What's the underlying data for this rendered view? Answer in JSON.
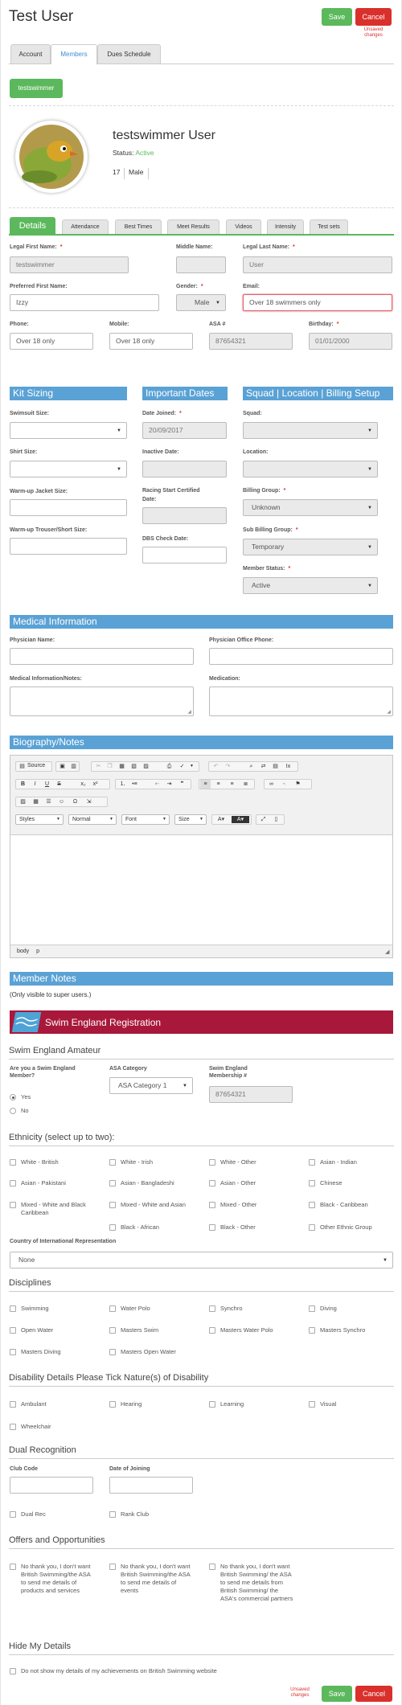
{
  "header": {
    "title": "Test User",
    "save_label": "Save",
    "cancel_label": "Cancel",
    "unsaved_line1": "Unsaved",
    "unsaved_line2": "changes"
  },
  "main_tabs": [
    {
      "label": "Account"
    },
    {
      "label": "Members"
    },
    {
      "label": "Dues Schedule"
    }
  ],
  "member_chip": "testswimmer",
  "profile": {
    "name": "testswimmer User",
    "status_label": "Status:",
    "status_value": "Active",
    "age": "17",
    "gender": "Male"
  },
  "detail_tabs": [
    {
      "label": "Details"
    },
    {
      "label": "Attendance"
    },
    {
      "label": "Best Times"
    },
    {
      "label": "Meet Results"
    },
    {
      "label": "Videos"
    },
    {
      "label": "Intensity"
    },
    {
      "label": "Test sets"
    }
  ],
  "details": {
    "legal_first_name_label": "Legal First Name:",
    "legal_first_name": "testswimmer",
    "middle_name_label": "Middle Name:",
    "middle_name": "",
    "legal_last_name_label": "Legal Last Name:",
    "legal_last_name": "User",
    "preferred_first_name_label": "Preferred First Name:",
    "preferred_first_name": "Izzy",
    "gender_label": "Gender:",
    "gender": "Male",
    "email_label": "Email:",
    "email": "Over 18 swimmers only",
    "phone_label": "Phone:",
    "phone": "Over 18 only",
    "mobile_label": "Mobile:",
    "mobile": "Over 18 only",
    "asa_label": "ASA #",
    "asa": "87654321",
    "birthday_label": "Birthday:",
    "birthday": "01/01/2000"
  },
  "kit": {
    "title": "Kit Sizing",
    "swimsuit_label": "Swimsuit Size:",
    "shirt_label": "Shirt Size:",
    "jacket_label": "Warm-up Jacket Size:",
    "trouser_label": "Warm-up Trouser/Short Size:"
  },
  "dates": {
    "title": "Important Dates",
    "joined_label": "Date Joined:",
    "joined": "20/09/2017",
    "inactive_label": "Inactive Date:",
    "racing_label_1": "Racing Start Certified",
    "racing_label_2": "Date:",
    "dbs_label": "DBS Check Date:"
  },
  "squad": {
    "title": "Squad | Location | Billing Setup",
    "squad_label": "Squad:",
    "location_label": "Location:",
    "billing_label": "Billing Group:",
    "billing": "Unknown",
    "sub_billing_label": "Sub Billing Group:",
    "sub_billing": "Temporary",
    "member_status_label": "Member Status:",
    "member_status": "Active"
  },
  "medical": {
    "title": "Medical Information",
    "physician_label": "Physician Name:",
    "physician_phone_label": "Physician Office Phone:",
    "notes_label": "Medical Information/Notes:",
    "medication_label": "Medication:"
  },
  "bio": {
    "title": "Biography/Notes",
    "source_label": "Source",
    "styles": "Styles",
    "normal": "Normal",
    "font": "Font",
    "size": "Size",
    "path_body": "body",
    "path_p": "p"
  },
  "member_notes": {
    "title": "Member Notes",
    "note": "(Only visible to super users.)"
  },
  "se": {
    "title": "Swim England Registration",
    "logo_text": "swim england",
    "amateur_title": "Swim England Amateur",
    "are_you_label_1": "Are you a Swim England",
    "are_you_label_2": "Member?",
    "yes": "Yes",
    "no": "No",
    "asa_category_label": "ASA Category",
    "asa_category": "ASA Category 1",
    "membership_label_1": "Swim England",
    "membership_label_2": "Membership #",
    "membership": "87654321"
  },
  "ethnicity": {
    "title": "Ethnicity (select up to two):",
    "options": [
      "White - British",
      "White - Irish",
      "White - Other",
      "Asian - Indian",
      "Asian - Pakistani",
      "Asian - Bangladeshi",
      "Asian - Other",
      "Chinese",
      "Mixed - White and Black Caribbean",
      "Mixed - White and Asian",
      "Mixed - Other",
      "Black - Caribbean",
      "Black - African",
      "Black - Other",
      "Other Ethnic Group"
    ],
    "country_label": "Country of International Representation",
    "country": "None"
  },
  "disciplines": {
    "title": "Disciplines",
    "options": [
      "Swimming",
      "Water Polo",
      "Synchro",
      "Diving",
      "Open Water",
      "Masters Swim",
      "Masters Water Polo",
      "Masters Synchro",
      "Masters Diving",
      "Masters Open Water"
    ]
  },
  "disability": {
    "title": "Disability Details Please Tick Nature(s) of Disability",
    "options": [
      "Ambulant",
      "Hearing",
      "Learning",
      "Visual",
      "Wheelchair"
    ]
  },
  "dual": {
    "title": "Dual Recognition",
    "club_code_label": "Club Code",
    "date_joining_label": "Date of Joining",
    "dual_rec": "Dual Rec",
    "rank_club": "Rank Club"
  },
  "offers": {
    "title": "Offers and Opportunities",
    "options": [
      "No thank you, I don't want British Swimming/the ASA to send me details of products and services",
      "No thank you, I don't want British Swimming/the ASA to send me details of events",
      "No thank you, I don't want British Swimming/ the ASA to send me details from British Swimming/ the ASA's commercial partners"
    ]
  },
  "hide": {
    "title": "Hide My Details",
    "option": "Do not show my details of my achievements on British Swimming website"
  },
  "colors": {
    "accent": "#5aa2d5",
    "save": "#5cb85c",
    "cancel": "#d9302c",
    "se_banner": "#a8183a"
  }
}
